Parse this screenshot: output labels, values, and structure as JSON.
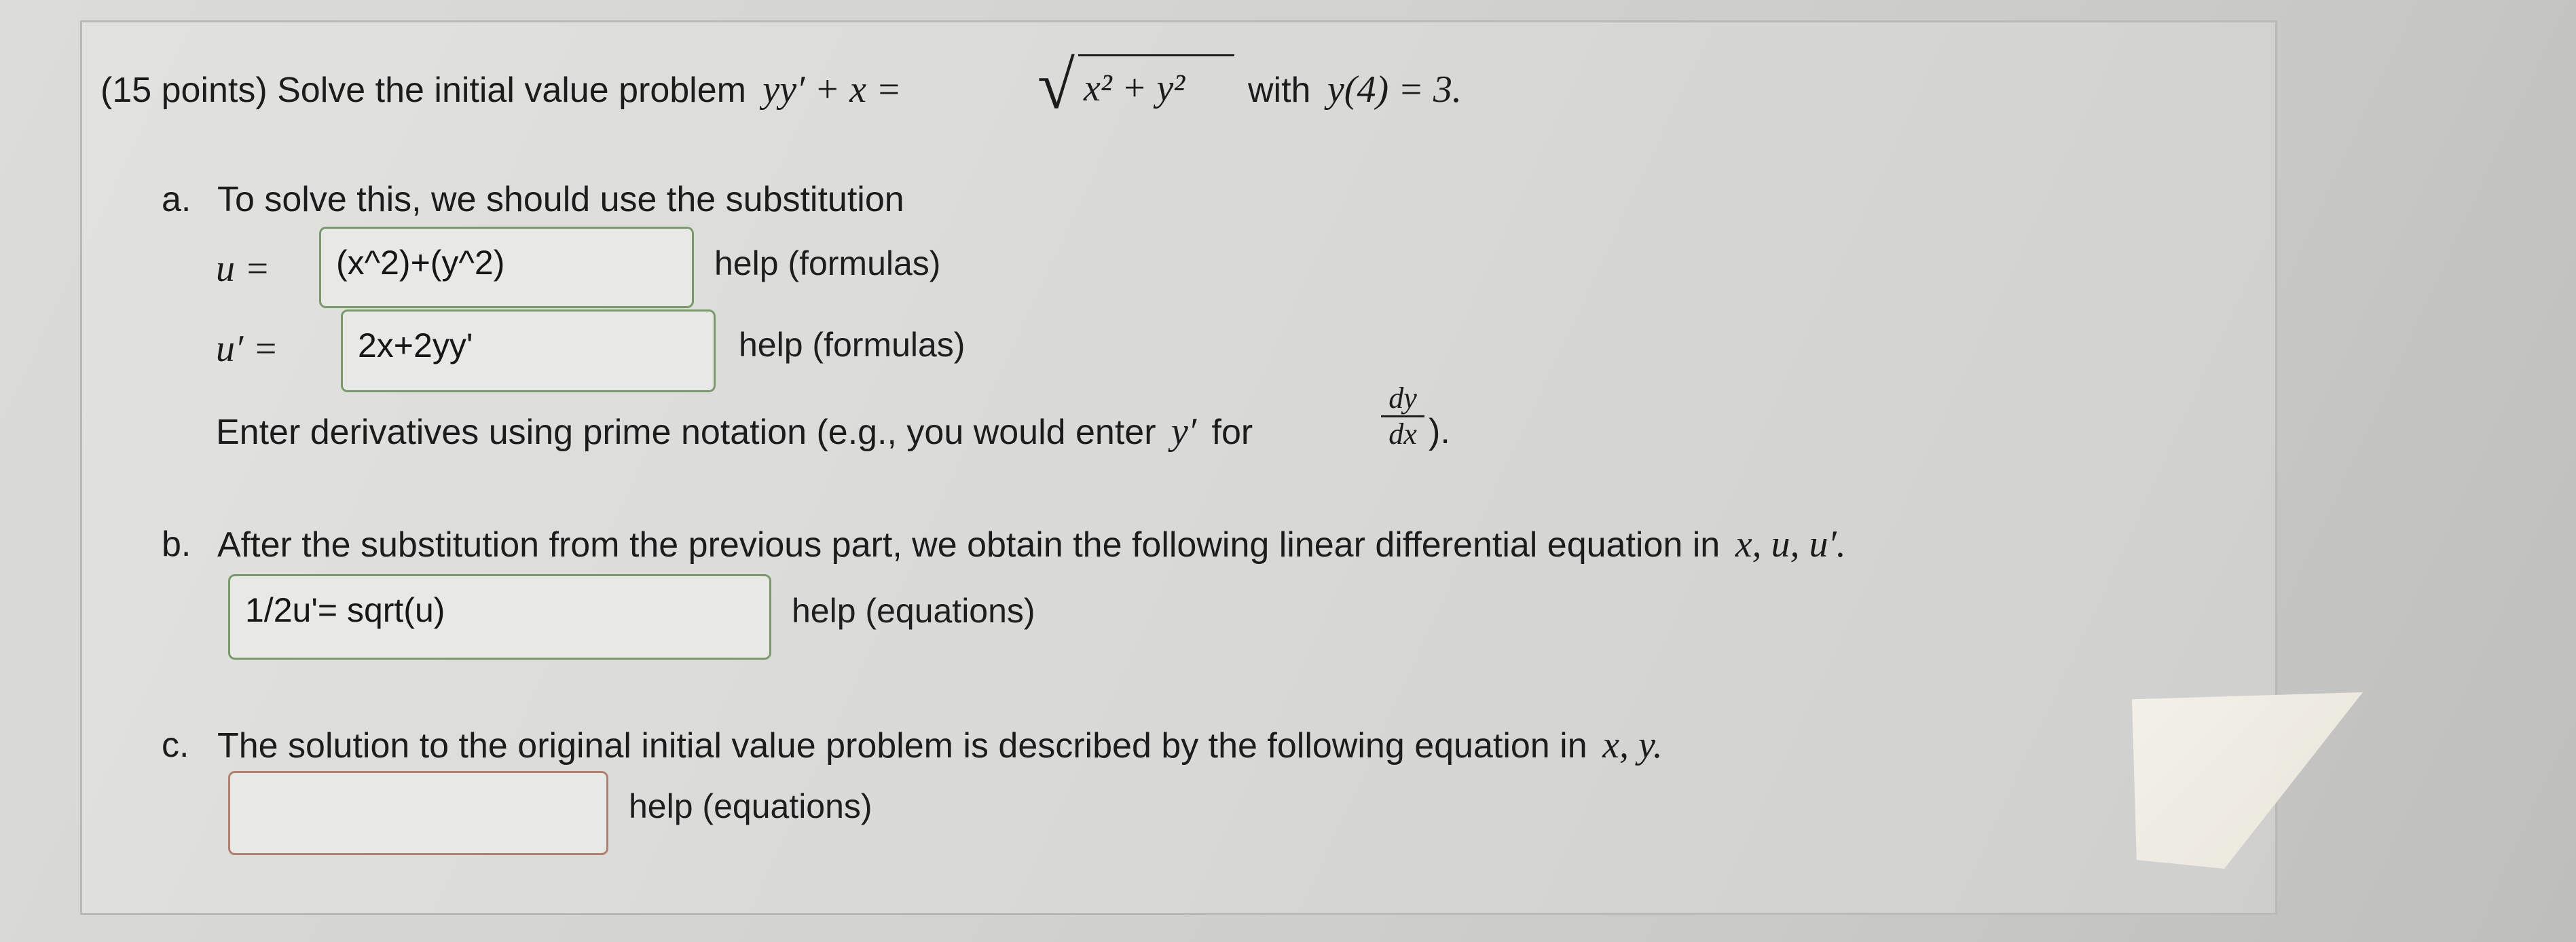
{
  "problem": {
    "prefix": "(15 points) Solve the initial value problem",
    "equation_lhs": "yy′ + x = ",
    "sqrt_radicand": "x² + y²",
    "with_label": "with",
    "condition": "y(4) = 3."
  },
  "part_a": {
    "marker": "a.",
    "intro": "To solve this, we should use the substitution",
    "u_label": "u =",
    "u_value": "(x^2)+(y^2)",
    "u_help": "help (formulas)",
    "uprime_label": "u′ =",
    "uprime_value": "2x+2yy'",
    "uprime_help": "help (formulas)",
    "note_prefix": "Enter derivatives using prime notation (e.g., you would enter",
    "note_var": "y′",
    "note_for": "for",
    "frac_num": "dy",
    "frac_den": "dx",
    "note_suffix": ")."
  },
  "part_b": {
    "marker": "b.",
    "intro": "After the substitution from the previous part, we obtain the following linear differential equation in",
    "vars": "x, u, u′.",
    "answer_value": "1/2u'= sqrt(u)",
    "help": "help (equations)"
  },
  "part_c": {
    "marker": "c.",
    "intro": "The solution to the original initial value problem is described by the following equation in",
    "vars": "x, y.",
    "answer_value": "",
    "help": "help (equations)"
  }
}
